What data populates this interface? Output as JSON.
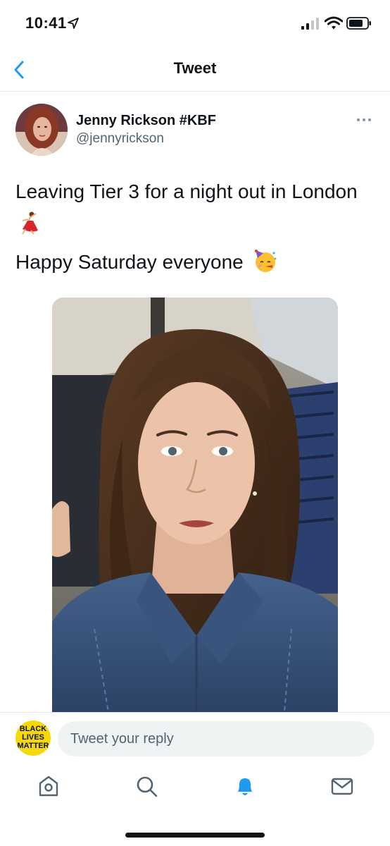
{
  "status_bar": {
    "time": "10:41"
  },
  "nav": {
    "title": "Tweet",
    "back_icon": "chevron-left-icon"
  },
  "tweet": {
    "display_name": "Jenny Rickson #KBF",
    "handle": "@jennyrickson",
    "text_line1": "Leaving Tier 3 for a night out in London",
    "text_line2": "Happy Saturday everyone",
    "emoji1": "dancer-emoji",
    "emoji2": "party-face-emoji",
    "more_icon": "more-horizontal-icon"
  },
  "reply": {
    "placeholder": "Tweet your reply",
    "avatar_text": "BLACK LIVES MATTER"
  },
  "tab_bar": {
    "items": [
      "home-icon",
      "search-icon",
      "notifications-icon",
      "messages-icon"
    ],
    "active": "notifications-icon"
  },
  "colors": {
    "accent": "#1d9bf0",
    "text_primary": "#0f1419",
    "text_secondary": "#536471",
    "reply_bg": "#eff3f4"
  }
}
